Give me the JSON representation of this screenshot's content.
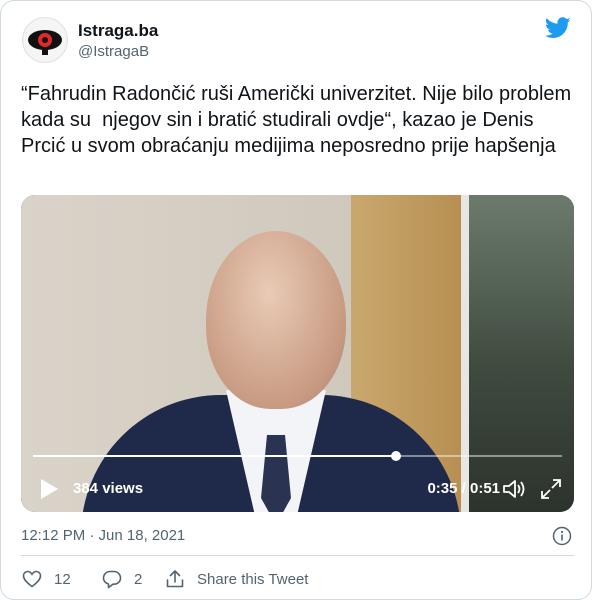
{
  "author": {
    "name": "Istraga.ba",
    "handle": "@IstragaB"
  },
  "tweet": {
    "text": "“Fahrudin Radončić ruši Američki univerzitet. Nije bilo problem kada su  njegov sin i bratić studirali ovdje“, kazao je Denis Prcić u svom obraćanju medijima neposredno prije hapšenja",
    "timestamp": "12:12 PM · Jun 18, 2021"
  },
  "video": {
    "views": "384 views",
    "time": "0:35 / 0:51",
    "progress_fraction": 0.686
  },
  "actions": {
    "likes": "12",
    "replies": "2",
    "share_label": "Share this Tweet"
  },
  "colors": {
    "twitter_blue": "#1d9bf0",
    "secondary_text": "#536471",
    "border": "#cfd9de"
  },
  "icons": [
    "istraga-logo-icon",
    "twitter-bird-icon",
    "play-icon",
    "volume-icon",
    "fullscreen-icon",
    "info-icon",
    "heart-icon",
    "reply-icon",
    "share-icon"
  ]
}
